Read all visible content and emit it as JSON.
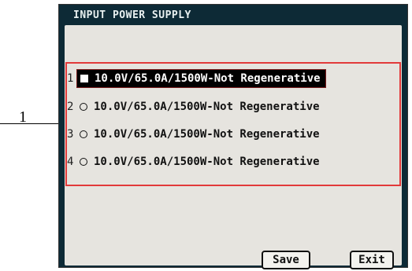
{
  "callout": {
    "label": "1"
  },
  "window": {
    "title": "INPUT POWER SUPPLY"
  },
  "options": [
    {
      "index": "1",
      "label": "10.0V/65.0A/1500W-Not Regenerative",
      "selected": true
    },
    {
      "index": "2",
      "label": "10.0V/65.0A/1500W-Not Regenerative",
      "selected": false
    },
    {
      "index": "3",
      "label": "10.0V/65.0A/1500W-Not Regenerative",
      "selected": false
    },
    {
      "index": "4",
      "label": "10.0V/65.0A/1500W-Not Regenerative",
      "selected": false
    }
  ],
  "buttons": {
    "save": "Save",
    "exit": "Exit"
  },
  "colors": {
    "screen_bg": "#0d2a36",
    "panel_bg": "#e6e4df",
    "highlight": "#e23a3a",
    "selected_bg": "#000000"
  }
}
